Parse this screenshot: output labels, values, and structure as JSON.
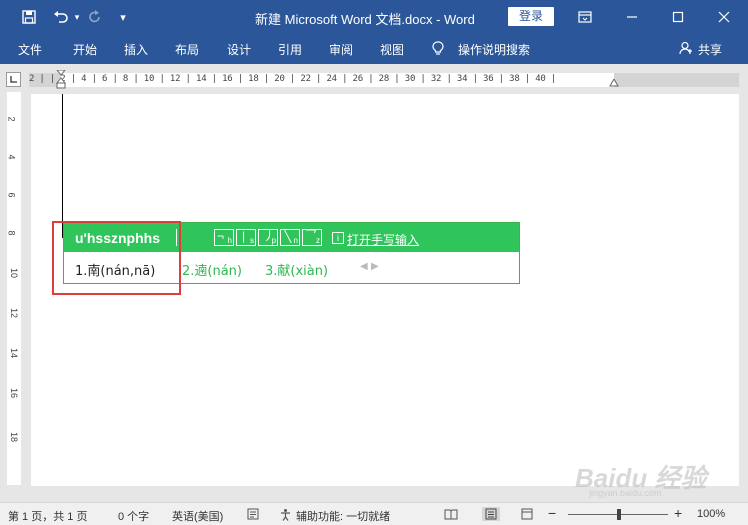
{
  "titlebar": {
    "save_icon": "save-icon",
    "undo_icon": "undo-icon",
    "redo_icon": "redo-icon",
    "customize_icon": "customize-icon",
    "title": "新建 Microsoft Word 文档.docx  -  Word",
    "login_label": "登录",
    "ribbon_display_icon": "ribbon-display-icon",
    "minimize_icon": "minimize-icon",
    "maximize_icon": "maximize-icon",
    "close_icon": "close-icon"
  },
  "ribbon": {
    "tabs": [
      "文件",
      "开始",
      "插入",
      "布局",
      "设计",
      "引用",
      "审阅",
      "视图"
    ],
    "tell_me": "操作说明搜索",
    "tell_me_icon": "lightbulb-icon",
    "share_label": "共享",
    "share_icon": "person-icon"
  },
  "ruler": {
    "horizontal": "2 | | 2 | 4 | 6 | 8 | 10 | 12 | 14 | 16 | 18 | 20 | 22 | 24 | 26 | 28 | 30 | 32 | 34 | 36 | 38 | 40 |",
    "vertical": [
      "2",
      "4",
      "6",
      "8",
      "10",
      "12",
      "14",
      "16",
      "18"
    ]
  },
  "ime": {
    "input": "u'hssznphhs",
    "strokes": [
      "h",
      "s",
      "p",
      "n",
      "z"
    ],
    "handwriting_label": "打开手写输入",
    "handwriting_icon": "handwriting-icon",
    "candidates": [
      "1.南(nán,nā)",
      "2.遖(nán)",
      "3.献(xiàn)"
    ],
    "prev_icon": "chevron-left-icon",
    "next_icon": "chevron-right-icon"
  },
  "status": {
    "page": "第 1 页，共 1 页",
    "words": "0 个字",
    "language": "英语(美国)",
    "accessibility": "辅助功能: 一切就绪",
    "zoom": "100%",
    "zoom_level": 1.0
  },
  "watermark": {
    "main": "Baidu 经验",
    "sub": "jingyan.baidu.com"
  },
  "colors": {
    "brand": "#2b579a",
    "ime_green": "#2fc55a",
    "highlight_red": "#e03c3c"
  }
}
